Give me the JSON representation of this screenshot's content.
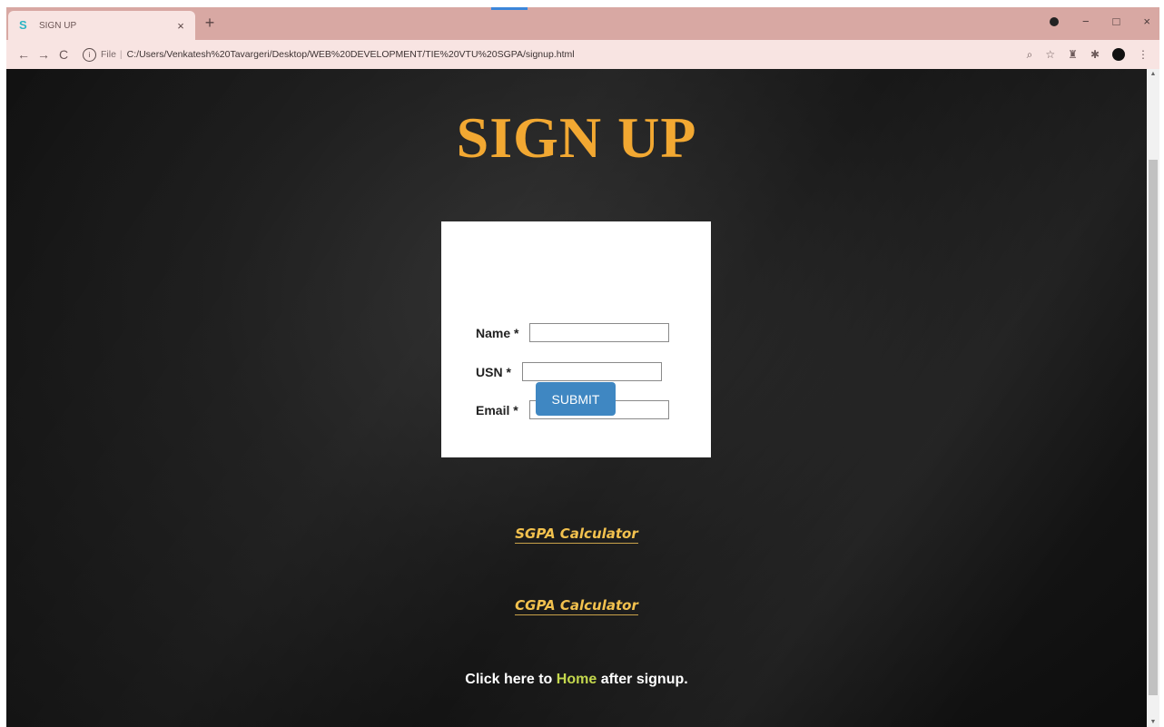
{
  "browser": {
    "tab_title": "SIGN UP",
    "tab_favicon": "S",
    "tab_close": "×",
    "new_tab": "+",
    "url_scheme": "File",
    "url_path": "C:/Users/Venkatesh%20Tavargeri/Desktop/WEB%20DEVELOPMENT/TIE%20VTU%20SGPA/signup.html",
    "window_controls": {
      "minimize": "−",
      "maximize": "□",
      "close": "×"
    }
  },
  "page": {
    "title": "SIGN UP",
    "form": {
      "name_label": "Name *",
      "usn_label": "USN *",
      "email_label": "Email *",
      "name_value": "",
      "usn_value": "",
      "email_value": "",
      "submit_label": "SUBMIT"
    },
    "links": {
      "sgpa": "SGPA Calculator",
      "cgpa": "CGPA Calculator"
    },
    "home_line": {
      "prefix": "Click here to",
      "link": "Home",
      "suffix": "after signup."
    }
  },
  "colors": {
    "title": "#f2a832",
    "link": "#f2c14e",
    "home_link": "#c4d84d",
    "submit_bg": "#3f87c2",
    "tabstrip": "#d8a8a3"
  },
  "icons": [
    "back-arrow-icon",
    "forward-arrow-icon",
    "reload-icon",
    "info-icon",
    "zoom-icon",
    "star-icon",
    "extension-icon",
    "puzzle-icon",
    "profile-avatar",
    "more-icon"
  ]
}
